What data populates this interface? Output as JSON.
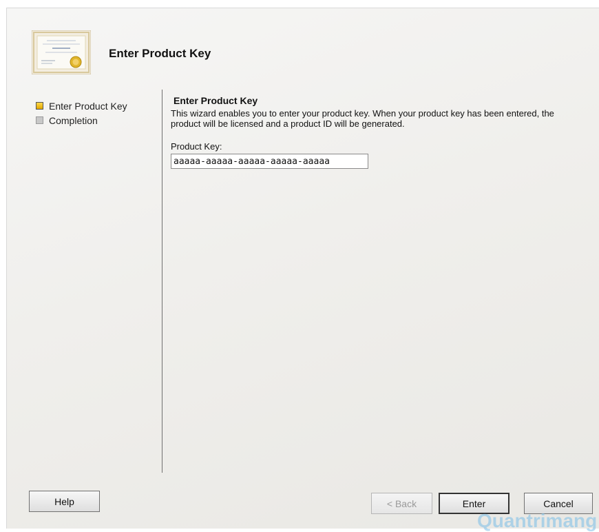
{
  "header": {
    "title": "Enter Product Key",
    "icon": "certificate-icon"
  },
  "steps": [
    {
      "label": "Enter Product Key",
      "state": "active"
    },
    {
      "label": "Completion",
      "state": "inactive"
    }
  ],
  "content": {
    "title": "Enter Product Key",
    "description": "This wizard enables you to enter your product key. When your product key has been entered, the product will be licensed and a product ID will be generated.",
    "field_label": "Product Key:",
    "field_value": "aaaaa-aaaaa-aaaaa-aaaaa-aaaaa"
  },
  "buttons": {
    "help": "Help",
    "back": "< Back",
    "enter": "Enter",
    "cancel": "Cancel"
  },
  "watermark": "Quantrimang",
  "colors": {
    "active_step": "#f2c200",
    "inactive_step": "#c8c8c8",
    "watermark": "#7cbfe8"
  }
}
